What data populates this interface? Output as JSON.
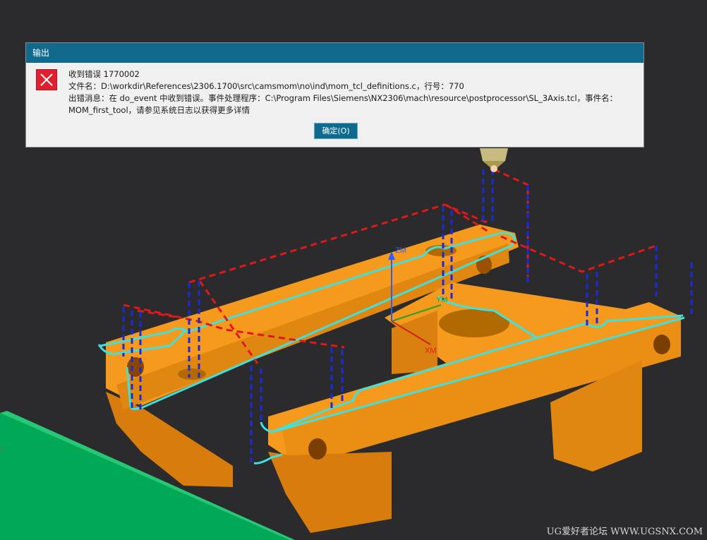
{
  "viewport": {
    "axes": {
      "z_label": "ZM",
      "y_label": "YM",
      "x_label": "XM",
      "side_label": "Y"
    }
  },
  "dialog": {
    "title": "输出",
    "icon": "error-x-icon",
    "line1": "收到错误 1770002",
    "line2": "文件名：D:\\workdir\\References\\2306.1700\\src\\camsmom\\no\\ind\\mom_tcl_definitions.c，行号：770",
    "line3": "出错消息：在 do_event 中收到错误。事件处理程序：C:\\Program Files\\Siemens\\NX2306\\mach\\resource\\postprocessor\\SL_3Axis.tcl，事件名：",
    "line4": "MOM_first_tool，请参见系统日志以获得更多详情",
    "ok_label": "确定(O)"
  },
  "watermark": "UG爱好者论坛 WWW.UGSNX.COM",
  "colors": {
    "part": "#f59a1c",
    "toolpath_cut": "#3fe0e0",
    "toolpath_rapid": "#e01818",
    "toolpath_feed": "#1a2ad8",
    "fixture": "#00b05a",
    "dialog_title": "#0f6a8e"
  }
}
